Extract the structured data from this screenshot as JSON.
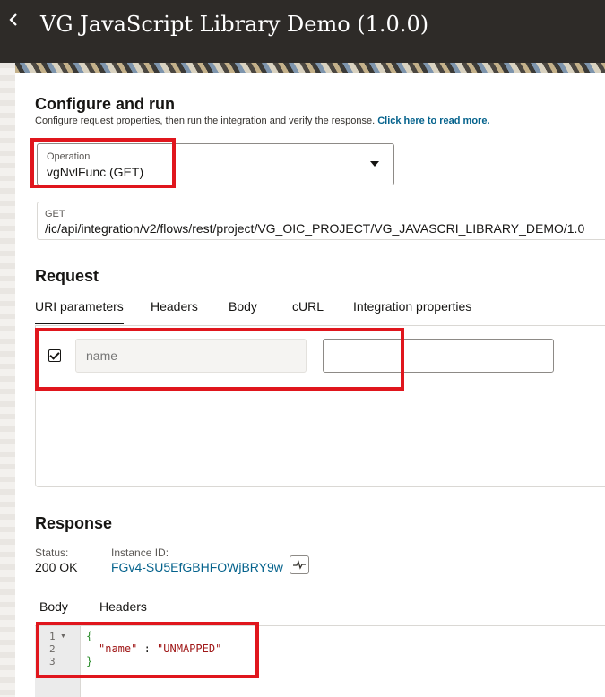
{
  "header": {
    "back_icon": "chevron-left-icon",
    "title": "VG JavaScript Library Demo (1.0.0)"
  },
  "configure": {
    "heading": "Configure and run",
    "description": "Configure request properties, then run the integration and verify the response.",
    "read_more_link": "Click here to read more.",
    "operation_label": "Operation",
    "operation_value": "vgNvlFunc (GET)",
    "method": "GET",
    "endpoint_url": "/ic/api/integration/v2/flows/rest/project/VG_OIC_PROJECT/VG_JAVASCRI_LIBRARY_DEMO/1.0"
  },
  "request": {
    "heading": "Request",
    "tabs": [
      {
        "label": "URI parameters",
        "active": true
      },
      {
        "label": "Headers",
        "active": false
      },
      {
        "label": "Body",
        "active": false
      },
      {
        "label": "cURL",
        "active": false
      },
      {
        "label": "Integration properties",
        "active": false
      }
    ],
    "params": [
      {
        "checked": true,
        "name_placeholder": "name",
        "value": ""
      }
    ]
  },
  "response": {
    "heading": "Response",
    "status_label": "Status:",
    "status_value": "200 OK",
    "instance_label": "Instance ID:",
    "instance_value": "FGv4-SU5EfGBHFOWjBRY9w",
    "activity_icon": "activity-stream-icon",
    "tabs": [
      {
        "label": "Body",
        "active": true
      },
      {
        "label": "Headers",
        "active": false
      }
    ],
    "body": {
      "line_numbers": [
        "1",
        "2",
        "3"
      ],
      "open_brace": "{",
      "key": "\"name\"",
      "separator": " : ",
      "value": "\"UNMAPPED\"",
      "close_brace": "}"
    }
  },
  "colors": {
    "highlight": "#e0161d",
    "link": "#04628c",
    "topbar": "#2e2b28"
  }
}
